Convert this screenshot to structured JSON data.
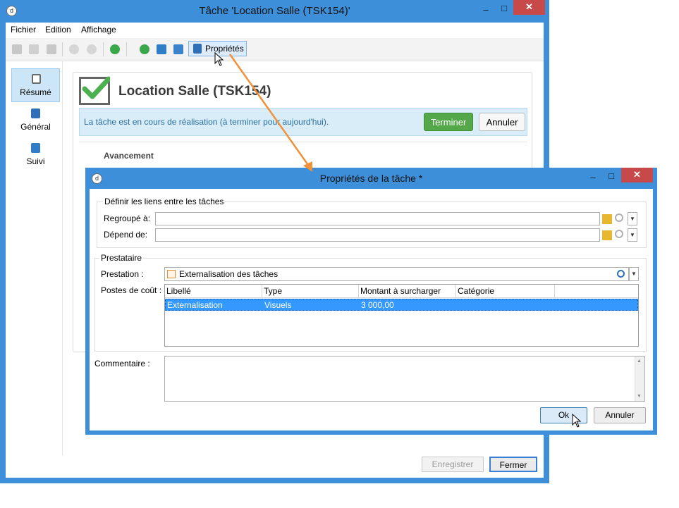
{
  "main_window": {
    "title": "Tâche 'Location Salle (TSK154)'",
    "menu": [
      "Fichier",
      "Edition",
      "Affichage"
    ],
    "toolbar": {
      "properties_label": "Propriétés"
    },
    "sidebar": [
      {
        "label": "Résumé",
        "icon": "checkbox-icon",
        "selected": true
      },
      {
        "label": "Général",
        "icon": "clipboard-icon",
        "selected": false
      },
      {
        "label": "Suivi",
        "icon": "tracking-icon",
        "selected": false
      }
    ],
    "task": {
      "title": "Location Salle (TSK154)",
      "status_text": "La tâche est en cours de réalisation (à terminer pour aujourd'hui).",
      "finish_button": "Terminer",
      "cancel_button": "Annuler",
      "section_label": "Avancement"
    },
    "buttons": {
      "save": "Enregistrer",
      "close": "Fermer"
    }
  },
  "dialog": {
    "title": "Propriétés de la tâche *",
    "links_group": "Définir les liens entre les tâches",
    "grouped_label": "Regroupé à:",
    "grouped_value": "",
    "depends_label": "Dépend de:",
    "depends_value": "",
    "provider_group": "Prestataire",
    "service_label": "Prestation :",
    "service_value": "Externalisation des tâches",
    "cost_label": "Postes de coût :",
    "columns": [
      "Libellé",
      "Type",
      "Montant à surcharger",
      "Catégorie"
    ],
    "rows": [
      {
        "libelle": "Externalisation",
        "type": "Visuels",
        "montant": "3 000,00",
        "categorie": ""
      }
    ],
    "comment_label": "Commentaire :",
    "comment_value": "",
    "ok": "Ok",
    "cancel": "Annuler"
  },
  "colors": {
    "title_bar": "#3c8fd8",
    "close_button": "#c74949",
    "accent_orange": "#f0923a",
    "finish_green": "#55a84a",
    "selection_blue": "#3399ff"
  }
}
